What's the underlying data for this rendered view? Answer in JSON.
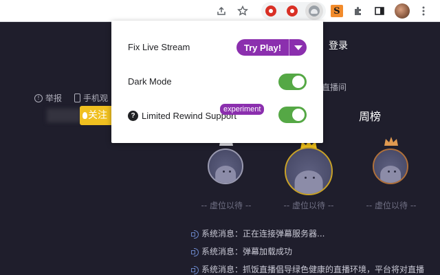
{
  "popup": {
    "fix_live_stream_label": "Fix Live Stream",
    "try_play_label": "Try Play!",
    "dark_mode_label": "Dark Mode",
    "dark_mode_on": true,
    "limited_rewind_label": "Limited Rewind Support",
    "limited_rewind_on": true,
    "experiment_badge": "experiment",
    "help_glyph": "?",
    "accent_color": "#8b2fae",
    "toggle_color": "#55a845"
  },
  "page": {
    "login_label": "登录",
    "report_label": "举报",
    "phone_label": "手机观",
    "live_room_label": "直播间",
    "follow_label": "关注",
    "weekly_rank_label": "周榜",
    "rank_placeholders": [
      "-- 虚位以待 --",
      "-- 虚位以待 --",
      "-- 虚位以待 --"
    ],
    "messages": [
      "系统消息：正在连接弹幕服务器...",
      "系统消息：弹幕加载成功",
      "系统消息：抓饭直播倡导绿色健康的直播环境，平台将对直播"
    ]
  },
  "toolbar": {
    "icons": [
      "share-icon",
      "star-icon",
      "extension-red-1-icon",
      "extension-red-2-icon",
      "extension-active-icon",
      "extension-s-icon",
      "puzzle-icon",
      "sidepanel-icon",
      "profile-avatar"
    ]
  }
}
